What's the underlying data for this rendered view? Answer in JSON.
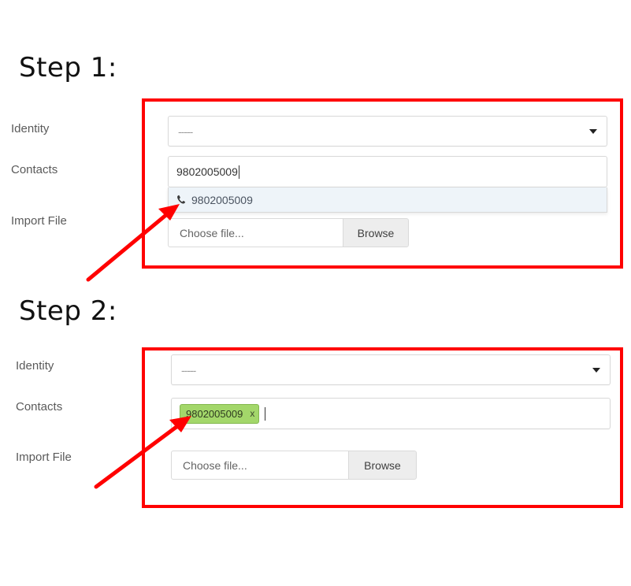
{
  "steps": [
    {
      "title": "Step 1:",
      "labels": {
        "identity": "Identity",
        "contacts": "Contacts",
        "import_file": "Import File"
      },
      "identity_select": {
        "value": "-----",
        "caret_icon": "chevron-down-icon"
      },
      "contacts_input": {
        "value": "9802005009",
        "suggestions": [
          {
            "icon": "phone-icon",
            "label": "9802005009"
          }
        ]
      },
      "file_input": {
        "placeholder": "Choose file...",
        "button_label": "Browse"
      }
    },
    {
      "title": "Step 2:",
      "labels": {
        "identity": "Identity",
        "contacts": "Contacts",
        "import_file": "Import File"
      },
      "identity_select": {
        "value": "-----",
        "caret_icon": "chevron-down-icon"
      },
      "contacts_input": {
        "tags": [
          {
            "label": "9802005009",
            "remove_label": "x"
          }
        ]
      },
      "file_input": {
        "placeholder": "Choose file...",
        "button_label": "Browse"
      }
    }
  ],
  "annotations": {
    "highlight_color": "#ff0000",
    "arrow_color": "#ff0000",
    "tag_color": "#a3d76a",
    "suggestion_highlight_color": "#eef4f9"
  }
}
